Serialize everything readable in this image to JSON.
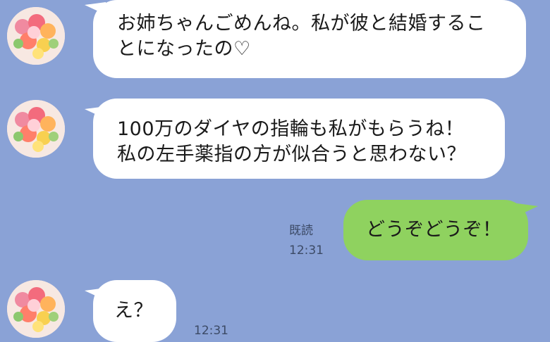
{
  "colors": {
    "background": "#8aa2d6",
    "incoming_bubble": "#ffffff",
    "outgoing_bubble": "#8fd25f",
    "meta_text": "#3c4a66"
  },
  "messages": [
    {
      "sender": "other",
      "avatar_icon": "flower-bouquet-icon",
      "text": "お姉ちゃんごめんね。私が彼と結婚するこ\nとになったの♡"
    },
    {
      "sender": "other",
      "avatar_icon": "flower-bouquet-icon",
      "text": "100万のダイヤの指輪も私がもらうね！\n私の左手薬指の方が似合うと思わない？"
    },
    {
      "sender": "me",
      "text": "どうぞどうぞ！",
      "read_label": "既読",
      "time": "12:31"
    },
    {
      "sender": "other",
      "avatar_icon": "flower-bouquet-icon",
      "text": "え？",
      "time": "12:31"
    }
  ]
}
